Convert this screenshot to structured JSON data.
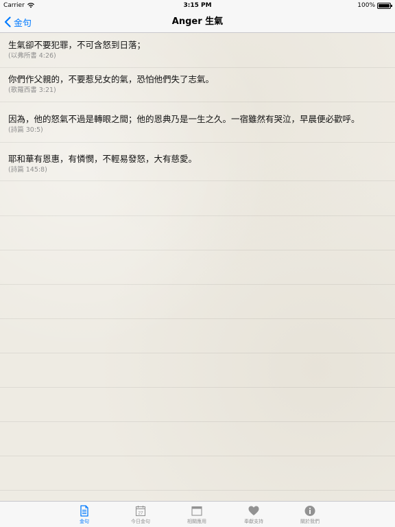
{
  "status_bar": {
    "carrier": "Carrier",
    "time": "3:15 PM",
    "battery": "100%"
  },
  "nav": {
    "back_label": "金句",
    "title": "Anger 生氣"
  },
  "verses": [
    {
      "text": "生氣卻不要犯罪，不可含怒到日落；",
      "ref": "(以弗所書 4:26)"
    },
    {
      "text": "你們作父親的，不要惹兒女的氣，恐怕他們失了志氣。",
      "ref": "(歌羅西書 3:21)"
    },
    {
      "text": "因為，他的怒氣不過是轉眼之間；他的恩典乃是一生之久。一宿雖然有哭泣，早晨便必歡呼。",
      "ref": "(詩篇 30:5)"
    },
    {
      "text": "耶和華有恩惠，有憐憫，不輕易發怒，大有慈愛。",
      "ref": "(詩篇 145:8)"
    }
  ],
  "tabs": [
    {
      "label": "金句",
      "icon": "document-icon",
      "active": true
    },
    {
      "label": "今日金句",
      "icon": "calendar-icon",
      "calendar_day": "27",
      "active": false
    },
    {
      "label": "相關應用",
      "icon": "window-icon",
      "active": false
    },
    {
      "label": "奉獻支持",
      "icon": "heart-icon",
      "active": false
    },
    {
      "label": "關於我們",
      "icon": "info-icon",
      "active": false
    }
  ],
  "colors": {
    "accent": "#007aff",
    "tab_inactive": "#929292",
    "reference_text": "#8e8e8e"
  }
}
